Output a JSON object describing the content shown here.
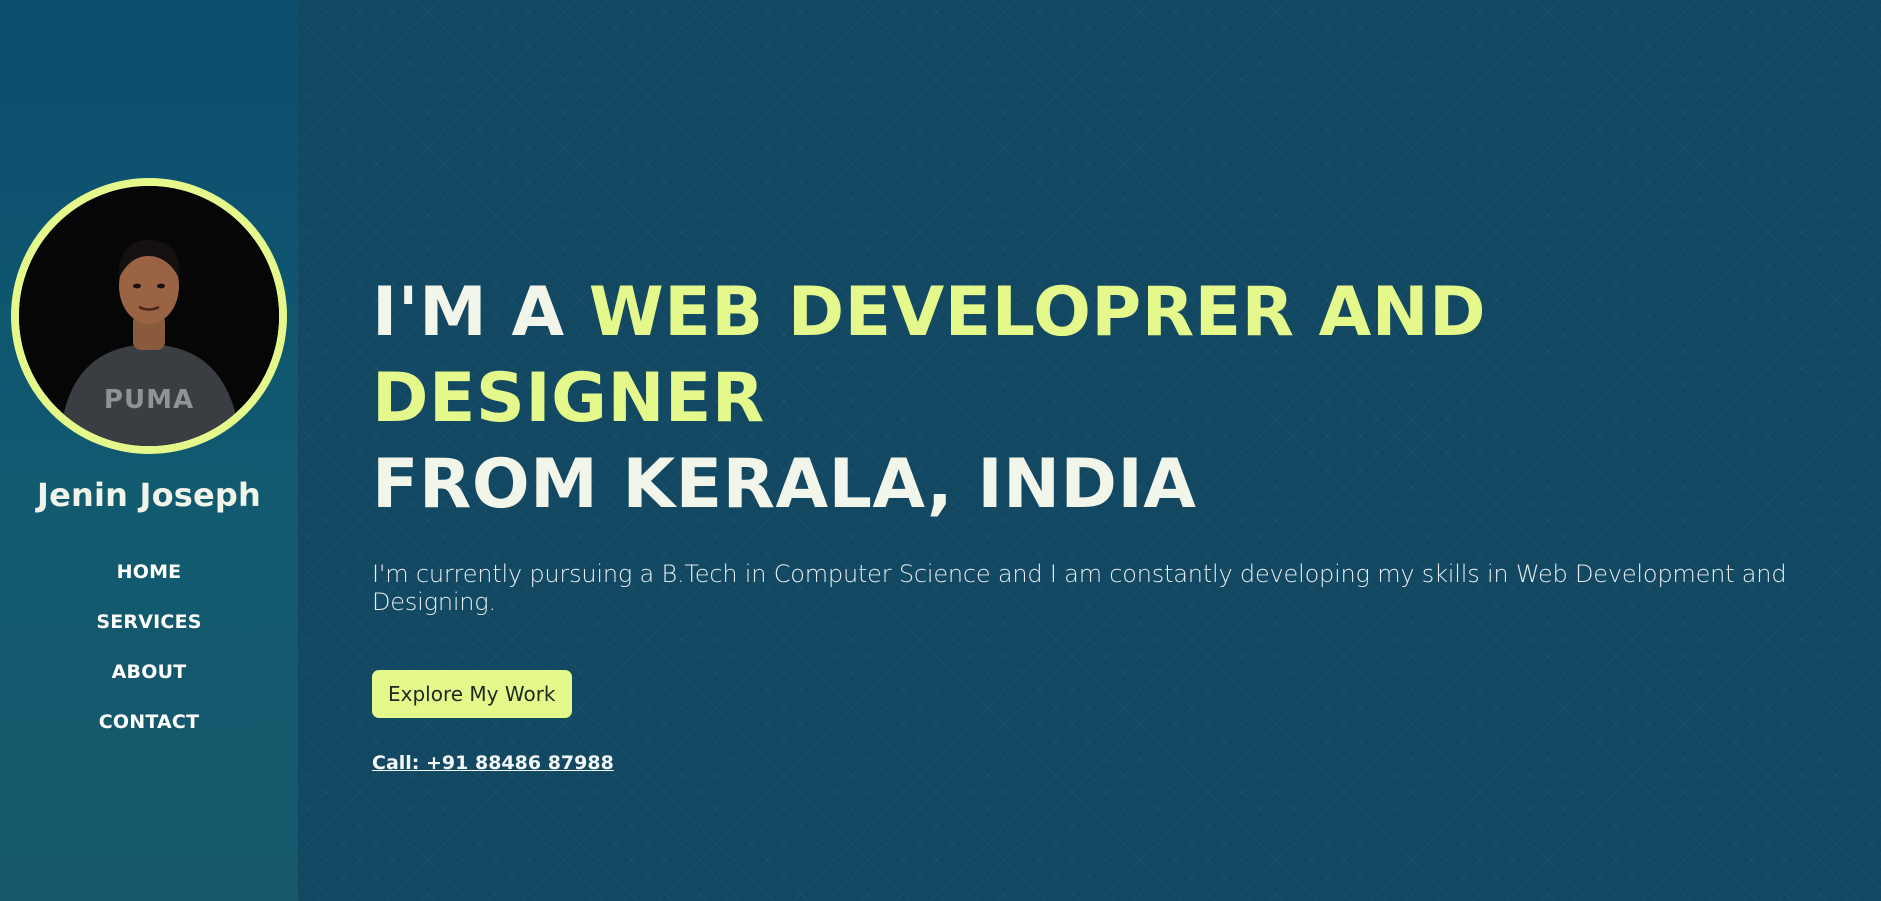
{
  "profile": {
    "name": "Jenin Joseph",
    "avatar_icon": "profile-photo",
    "accent_color": "#e4f88b"
  },
  "nav": {
    "items": [
      {
        "label": "HOME"
      },
      {
        "label": "SERVICES"
      },
      {
        "label": "ABOUT"
      },
      {
        "label": "CONTACT"
      }
    ]
  },
  "hero": {
    "headline_prefix": "I'M A ",
    "headline_accent": "WEB DEVELOPRER AND DESIGNER",
    "headline_suffix": "FROM KERALA, INDIA",
    "intro": "I'm currently pursuing a B.Tech in Computer Science and I am constantly developing my skills in Web Development and Designing.",
    "cta_label": "Explore My Work",
    "call_text": "Call: +91 88486 87988"
  },
  "colors": {
    "sidebar_bg": "#0b4e6e",
    "main_bg": "#124862",
    "accent": "#e4f88b",
    "text": "#f2f5ea"
  }
}
